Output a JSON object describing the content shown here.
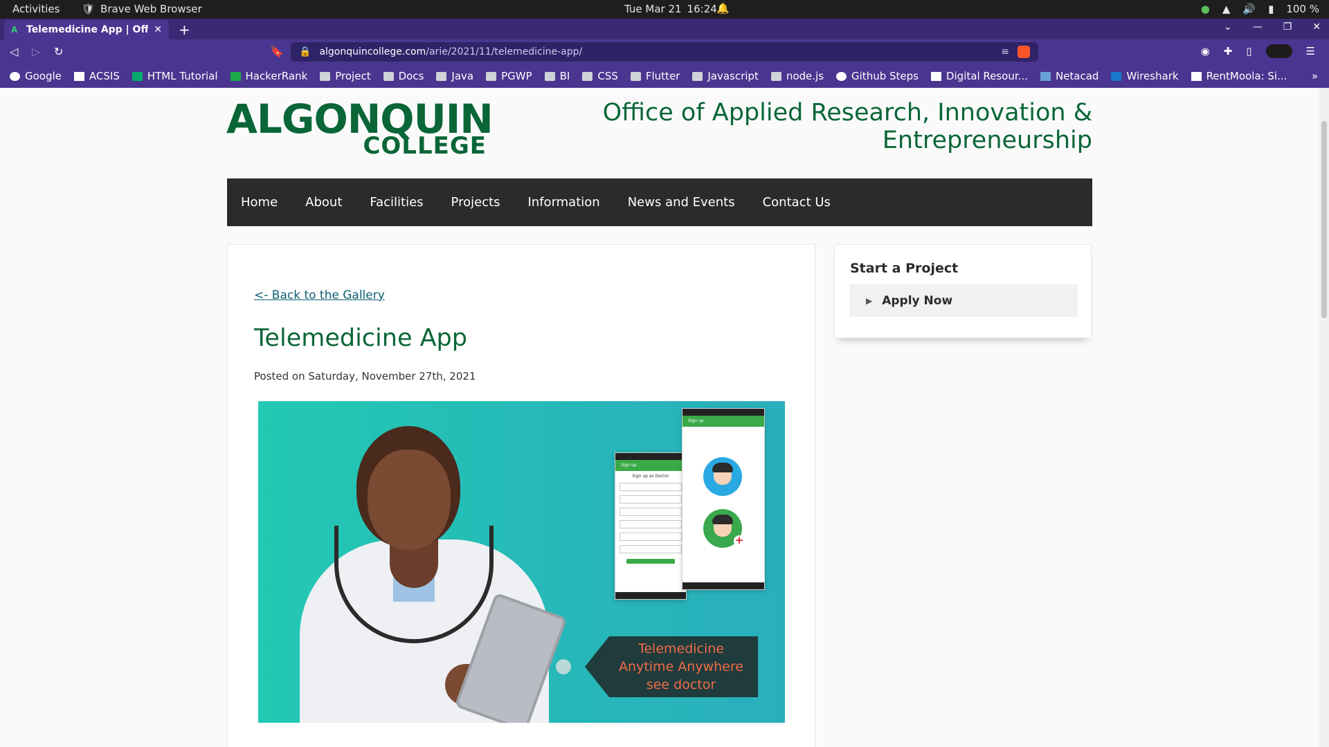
{
  "os": {
    "activities": "Activities",
    "app_name": "Brave Web Browser",
    "date": "Tue Mar 21",
    "time": "16:24",
    "battery": "100 %"
  },
  "browser": {
    "tab_title": "Telemedicine App | Office",
    "url_host": "algonquincollege.com",
    "url_path": "/arie/2021/11/telemedicine-app/"
  },
  "bookmarks": [
    {
      "label": "Google",
      "icon": "google-icon"
    },
    {
      "label": "ACSIS",
      "icon": "acsis-icon"
    },
    {
      "label": "HTML Tutorial",
      "icon": "w3-icon"
    },
    {
      "label": "HackerRank",
      "icon": "hackerrank-icon"
    },
    {
      "label": "Project",
      "icon": "folder-icon"
    },
    {
      "label": "Docs",
      "icon": "folder-icon"
    },
    {
      "label": "Java",
      "icon": "folder-icon"
    },
    {
      "label": "PGWP",
      "icon": "folder-icon"
    },
    {
      "label": "BI",
      "icon": "folder-icon"
    },
    {
      "label": "CSS",
      "icon": "folder-icon"
    },
    {
      "label": "Flutter",
      "icon": "folder-icon"
    },
    {
      "label": "Javascript",
      "icon": "folder-icon"
    },
    {
      "label": "node.js",
      "icon": "folder-icon"
    },
    {
      "label": "Github Steps",
      "icon": "github-icon"
    },
    {
      "label": "Digital Resour...",
      "icon": "algonquin-icon"
    },
    {
      "label": "Netacad",
      "icon": "netacad-icon"
    },
    {
      "label": "Wireshark",
      "icon": "wireshark-icon"
    },
    {
      "label": "RentMoola: Si...",
      "icon": "rentmoola-icon"
    }
  ],
  "site": {
    "logo_line1": "ALGONQUIN",
    "logo_line2": "COLLEGE",
    "office_line1": "Office of Applied Research, Innovation &",
    "office_line2": "Entrepreneurship",
    "nav": [
      "Home",
      "About",
      "Facilities",
      "Projects",
      "Information",
      "News and Events",
      "Contact Us"
    ]
  },
  "article": {
    "back_link": "<- Back to the Gallery",
    "title": "Telemedicine App",
    "posted": "Posted on Saturday, November 27th, 2021"
  },
  "hero": {
    "tag_line1": "Telemedicine",
    "tag_line2": "Anytime Anywhere",
    "tag_line3": "see doctor",
    "phone1_appbar": "Sign up",
    "phone1_caption": "Sign up as Doctor",
    "phone2_appbar": "Sign up"
  },
  "sidebar": {
    "title": "Start a Project",
    "apply": "Apply Now"
  },
  "colors": {
    "brand_green": "#0a6637",
    "nav_bg": "#2b2b2b",
    "browser_purple": "#4a3590"
  }
}
